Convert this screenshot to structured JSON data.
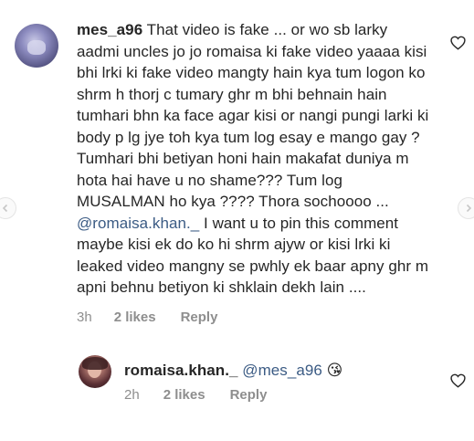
{
  "comment1": {
    "username": "mes_a96",
    "text": "That video is fake ... or wo sb larky aadmi uncles jo jo romaisa ki fake video yaaaa kisi bhi lrki ki fake video mangty hain kya tum logon ko shrm h thorj c tumary ghr m bhi behnain hain tumhari bhn ka face agar kisi or nangi pungi larki ki body p lg jye toh kya tum log esay e mango gay ? Tumhari bhi betiyan honi hain makafat duniya m hota hai have u no shame??? Tum log MUSALMAN ho kya ???? Thora sochoooo ... ",
    "mention": "@romaisa.khan._",
    "text_after": " I want u to pin this comment maybe kisi ek do ko hi shrm ajyw or kisi lrki ki leaked video mangny se pwhly ek baar apny ghr m apni behnu betiyon ki shklain dekh lain ....",
    "time": "3h",
    "likes": "2 likes",
    "reply": "Reply",
    "heart_icon": "heart-outline-icon"
  },
  "comment2": {
    "username": "romaisa.khan._",
    "mention": "@mes_a96",
    "emoji": "😘",
    "time": "2h",
    "likes": "2 likes",
    "reply": "Reply",
    "heart_icon": "heart-outline-icon"
  },
  "colors": {
    "mention": "#3b5b84",
    "meta": "#8e8e8e",
    "text": "#262626"
  }
}
